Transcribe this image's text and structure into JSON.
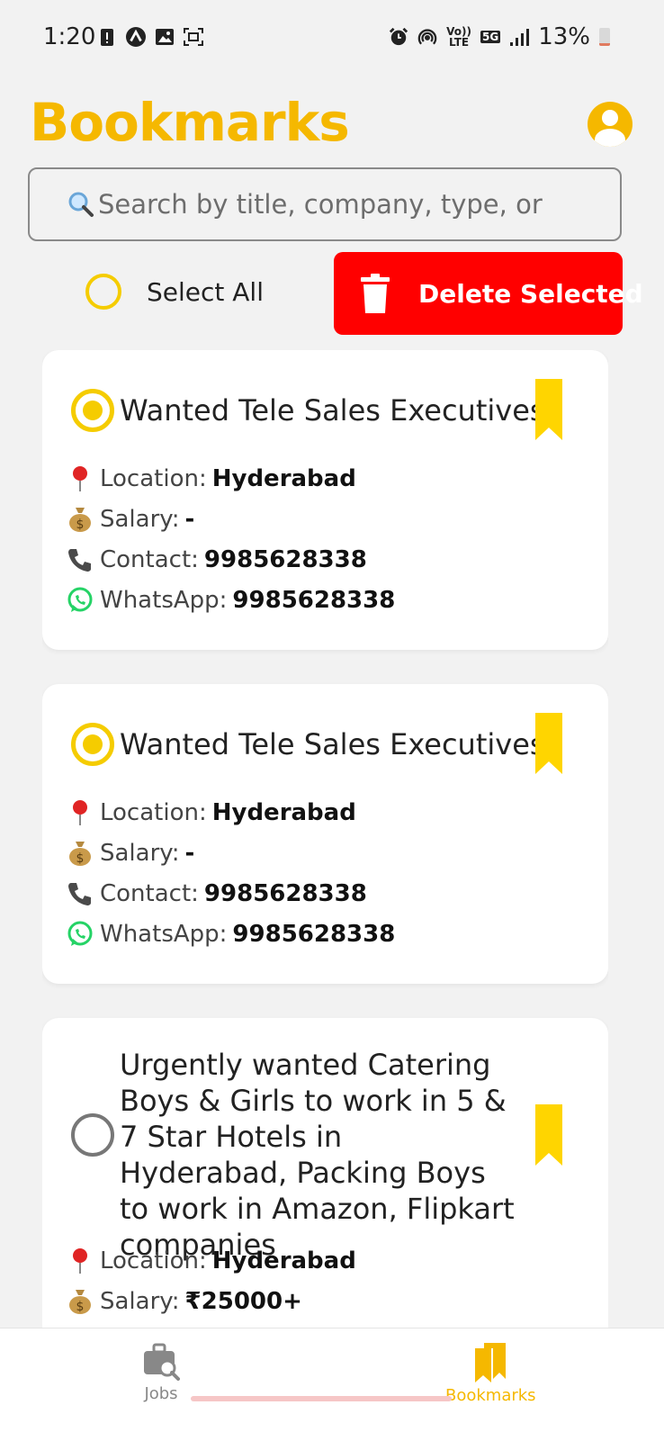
{
  "status_bar": {
    "time": "1:20",
    "battery": "13%",
    "battery_level": 0.13,
    "network": "5G",
    "lte_top": "Vo))",
    "lte_bottom": "LTE"
  },
  "header": {
    "title": "Bookmarks"
  },
  "search": {
    "placeholder": "Search by title, company, type, or"
  },
  "actions": {
    "select_all": "Select All",
    "delete_selected": "Delete Selected"
  },
  "labels": {
    "location": "Location:",
    "salary": "Salary:",
    "contact": "Contact:",
    "whatsapp": "WhatsApp:"
  },
  "cards": [
    {
      "title": "Wanted Tele Sales Executives",
      "selected": true,
      "location": "Hyderabad",
      "salary": "-",
      "contact": "9985628338",
      "whatsapp": "9985628338"
    },
    {
      "title": "Wanted Tele Sales Executives",
      "selected": true,
      "location": "Hyderabad",
      "salary": "-",
      "contact": "9985628338",
      "whatsapp": "9985628338"
    },
    {
      "title": "Urgently wanted Catering Boys & Girls to work in 5 & 7 Star Hotels in Hyderabad, Packing Boys to work in Amazon, Flipkart companies",
      "selected": false,
      "location": "Hyderabad",
      "salary": "₹25000+"
    }
  ],
  "nav": {
    "jobs": "Jobs",
    "bookmarks": "Bookmarks",
    "active": "bookmarks"
  },
  "colors": {
    "accent": "#f5b800",
    "danger": "#ff0000",
    "bookmark": "#ffd500"
  }
}
